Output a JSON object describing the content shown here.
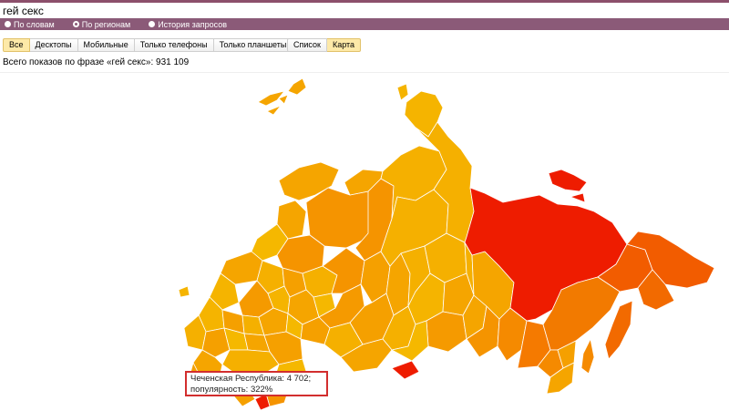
{
  "search": {
    "value": "гей секс"
  },
  "modes": [
    {
      "label": "По словам",
      "selected": false
    },
    {
      "label": "По регионам",
      "selected": true
    },
    {
      "label": "История запросов",
      "selected": false
    }
  ],
  "device_tabs": [
    {
      "label": "Все",
      "active": true
    },
    {
      "label": "Десктопы",
      "active": false
    },
    {
      "label": "Мобильные",
      "active": false
    },
    {
      "label": "Только телефоны",
      "active": false
    },
    {
      "label": "Только планшеты",
      "active": false
    }
  ],
  "view_tabs": [
    {
      "label": "Список",
      "active": false
    },
    {
      "label": "Карта",
      "active": true
    }
  ],
  "summary": {
    "text": "Всего показов по фразе «гей секс»: 931 109"
  },
  "tooltip": {
    "line1": "Чеченская Республика: 4 702;",
    "line2": "популярность: 322%"
  },
  "colors": {
    "accent_bar": "#8b5a78",
    "popularity_low": "#f5c000",
    "popularity_mid": "#f59a00",
    "popularity_high": "#f25c00",
    "popularity_max": "#ee1c00"
  }
}
